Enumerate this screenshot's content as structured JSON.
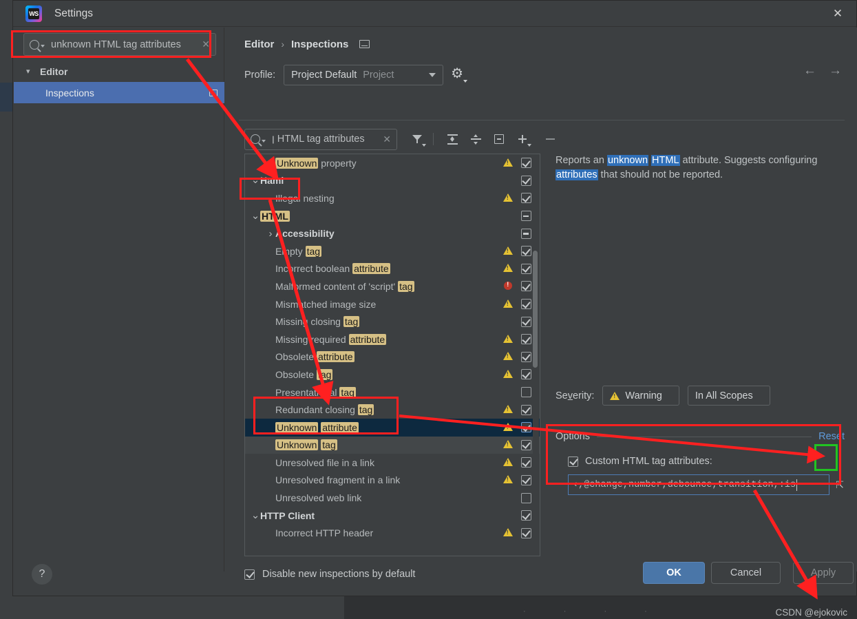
{
  "window": {
    "title": "Settings",
    "app_icon": "webstorm-icon",
    "close_icon": "close-icon"
  },
  "sidebar": {
    "search": {
      "value": "unknown HTML tag attributes",
      "clear_icon": "clear-icon",
      "search_icon": "search-icon"
    },
    "items": [
      {
        "label": "Editor",
        "expanded": true,
        "selected": false
      },
      {
        "label": "Inspections",
        "expanded": false,
        "selected": true
      }
    ]
  },
  "breadcrumb": {
    "parent": "Editor",
    "separator": "›",
    "current": "Inspections",
    "icon": "panel-icon"
  },
  "nav": {
    "back": "←",
    "forward": "→"
  },
  "profile": {
    "label": "Profile:",
    "value": "Project Default",
    "scope": "Project",
    "gear_icon": "gear-icon"
  },
  "toolbar": {
    "search_value": "ן HTML tag attributes",
    "icons": [
      "filter-icon",
      "expand-all-icon",
      "collapse-all-icon",
      "box-minus-icon",
      "add-icon",
      "remove-icon"
    ]
  },
  "tree": {
    "rows": [
      {
        "id": "unknown-property",
        "depth": 2,
        "bold": false,
        "segments": [
          {
            "t": "Unknown",
            "hl": true
          },
          {
            "t": " property",
            "hl": false
          }
        ],
        "severity": "warning",
        "check": "checked"
      },
      {
        "id": "haml",
        "depth": 1,
        "bold": true,
        "chevron": "⌄",
        "segments": [
          {
            "t": "Haml",
            "hl": false
          }
        ],
        "severity": "none",
        "check": "checked"
      },
      {
        "id": "illegal-nesting",
        "depth": 2,
        "bold": false,
        "segments": [
          {
            "t": "Illegal nesting",
            "hl": false
          }
        ],
        "severity": "warning",
        "check": "checked"
      },
      {
        "id": "html",
        "depth": 1,
        "bold": true,
        "chevron": "⌄",
        "segments": [
          {
            "t": "HTML",
            "hl": true
          }
        ],
        "severity": "none",
        "check": "dash"
      },
      {
        "id": "accessibility",
        "depth": 2,
        "bold": true,
        "chevron": "›",
        "segments": [
          {
            "t": "Accessibility",
            "hl": false
          }
        ],
        "severity": "none",
        "check": "dash"
      },
      {
        "id": "empty-tag",
        "depth": 2,
        "bold": false,
        "segments": [
          {
            "t": "Empty ",
            "hl": false
          },
          {
            "t": "tag",
            "hl": true
          }
        ],
        "severity": "warning",
        "check": "checked"
      },
      {
        "id": "incorrect-boolean-attribute",
        "depth": 2,
        "bold": false,
        "segments": [
          {
            "t": "Incorrect boolean ",
            "hl": false
          },
          {
            "t": "attribute",
            "hl": true
          }
        ],
        "severity": "warning",
        "check": "checked"
      },
      {
        "id": "malformed-script-tag",
        "depth": 2,
        "bold": false,
        "segments": [
          {
            "t": "Malformed content of 'script' ",
            "hl": false
          },
          {
            "t": "tag",
            "hl": true
          }
        ],
        "severity": "error",
        "check": "checked"
      },
      {
        "id": "mismatched-image-size",
        "depth": 2,
        "bold": false,
        "segments": [
          {
            "t": "Mismatched image size",
            "hl": false
          }
        ],
        "severity": "warning",
        "check": "checked"
      },
      {
        "id": "missing-closing-tag",
        "depth": 2,
        "bold": false,
        "segments": [
          {
            "t": "Missing closing ",
            "hl": false
          },
          {
            "t": "tag",
            "hl": true
          }
        ],
        "severity": "none",
        "check": "checked"
      },
      {
        "id": "missing-required-attribute",
        "depth": 2,
        "bold": false,
        "segments": [
          {
            "t": "Missing required ",
            "hl": false
          },
          {
            "t": "attribute",
            "hl": true
          }
        ],
        "severity": "warning",
        "check": "checked"
      },
      {
        "id": "obsolete-attribute",
        "depth": 2,
        "bold": false,
        "segments": [
          {
            "t": "Obsolete ",
            "hl": false
          },
          {
            "t": "attribute",
            "hl": true
          }
        ],
        "severity": "warning",
        "check": "checked"
      },
      {
        "id": "obsolete-tag",
        "depth": 2,
        "bold": false,
        "segments": [
          {
            "t": "Obsolete ",
            "hl": false
          },
          {
            "t": "tag",
            "hl": true
          }
        ],
        "severity": "warning",
        "check": "checked"
      },
      {
        "id": "presentational-tag",
        "depth": 2,
        "bold": false,
        "segments": [
          {
            "t": "Presentational ",
            "hl": false
          },
          {
            "t": "tag",
            "hl": true
          }
        ],
        "severity": "none",
        "check": "unchecked"
      },
      {
        "id": "redundant-closing-tag",
        "depth": 2,
        "bold": false,
        "segments": [
          {
            "t": "Redundant closing ",
            "hl": false
          },
          {
            "t": "tag",
            "hl": true
          }
        ],
        "severity": "warning",
        "check": "checked"
      },
      {
        "id": "unknown-attribute",
        "depth": 2,
        "bold": false,
        "selected": true,
        "segments": [
          {
            "t": "Unknown",
            "hl": true
          },
          {
            "t": " ",
            "hl": false
          },
          {
            "t": "attribute",
            "hl": true
          }
        ],
        "severity": "warning",
        "check": "checked"
      },
      {
        "id": "unknown-tag",
        "depth": 2,
        "bold": false,
        "hovered": true,
        "segments": [
          {
            "t": "Unknown",
            "hl": true
          },
          {
            "t": " ",
            "hl": false
          },
          {
            "t": "tag",
            "hl": true
          }
        ],
        "severity": "warning",
        "check": "checked"
      },
      {
        "id": "unresolved-file-in-link",
        "depth": 2,
        "bold": false,
        "segments": [
          {
            "t": "Unresolved file in a link",
            "hl": false
          }
        ],
        "severity": "warning",
        "check": "checked"
      },
      {
        "id": "unresolved-fragment-in-link",
        "depth": 2,
        "bold": false,
        "segments": [
          {
            "t": "Unresolved fragment in a link",
            "hl": false
          }
        ],
        "severity": "warning",
        "check": "checked"
      },
      {
        "id": "unresolved-web-link",
        "depth": 2,
        "bold": false,
        "segments": [
          {
            "t": "Unresolved web link",
            "hl": false
          }
        ],
        "severity": "none",
        "check": "unchecked"
      },
      {
        "id": "http-client",
        "depth": 1,
        "bold": true,
        "chevron": "⌄",
        "segments": [
          {
            "t": "HTTP Client",
            "hl": false
          }
        ],
        "severity": "none",
        "check": "checked"
      },
      {
        "id": "incorrect-http-header",
        "depth": 2,
        "bold": false,
        "segments": [
          {
            "t": "Incorrect HTTP header",
            "hl": false
          }
        ],
        "severity": "warning",
        "check": "checked"
      }
    ]
  },
  "description": {
    "parts": [
      {
        "t": "Reports an ",
        "hl": false
      },
      {
        "t": "unknown",
        "hl": true
      },
      {
        "t": " ",
        "hl": false
      },
      {
        "t": "HTML",
        "hl": true
      },
      {
        "t": " attribute. Suggests configuring ",
        "hl": false
      },
      {
        "t": "attributes",
        "hl": true
      },
      {
        "t": " that should not be reported.",
        "hl": false
      }
    ]
  },
  "severity": {
    "label": "Severity:",
    "value": "Warning",
    "scope": "In All Scopes",
    "icon": "warning-icon"
  },
  "options": {
    "title": "Options",
    "reset": "Reset",
    "checkbox_label": "Custom HTML tag attributes:",
    "checkbox_checked": true,
    "input_value": "‹,@change,number,debounce,transition,:is",
    "expand_icon": "expand-input-icon"
  },
  "footer_checkbox": {
    "label": "Disable new inspections by default",
    "checked": true
  },
  "buttons": {
    "help": "?",
    "ok": "OK",
    "cancel": "Cancel",
    "apply": "Apply"
  },
  "watermark": "CSDN @ejokovic",
  "colors": {
    "accent_blue": "#4a76a8",
    "highlight_yellow": "#d6c085",
    "selection_blue": "#4b6eaf",
    "annotation_red": "#ff2020",
    "annotation_green": "#21c421",
    "warning_yellow": "#e5c233",
    "error_red": "#c0392b"
  }
}
